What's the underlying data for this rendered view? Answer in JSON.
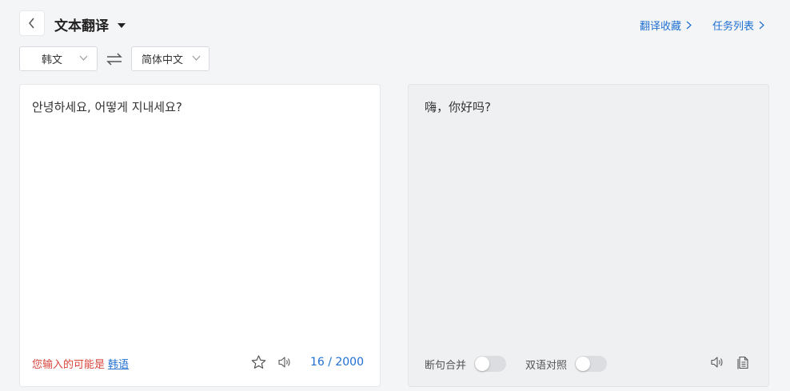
{
  "header": {
    "back_icon": "chevron-left-icon",
    "title": "文本翻译",
    "title_caret": "caret-down-icon",
    "links": [
      {
        "label": "翻译收藏",
        "icon": "chevron-right-icon"
      },
      {
        "label": "任务列表",
        "icon": "chevron-right-icon"
      }
    ]
  },
  "languages": {
    "source": "韩文",
    "target": "简体中文",
    "swap_icon": "swap-icon"
  },
  "source_panel": {
    "text": "안녕하세요, 어떻게 지내세요?",
    "detect_prefix": "您输入的可能是",
    "detect_language": "韩语",
    "counter": "16 / 2000",
    "icons": [
      "star-icon",
      "speaker-icon"
    ]
  },
  "target_panel": {
    "text": "嗨，你好吗?",
    "toggles": [
      {
        "label": "断句合并",
        "on": false
      },
      {
        "label": "双语对照",
        "on": false
      }
    ],
    "icons": [
      "speaker-icon",
      "copy-icon"
    ]
  },
  "colors": {
    "accent": "#1f6fd1",
    "warning": "#d9443b",
    "background": "#f4f5f7"
  }
}
